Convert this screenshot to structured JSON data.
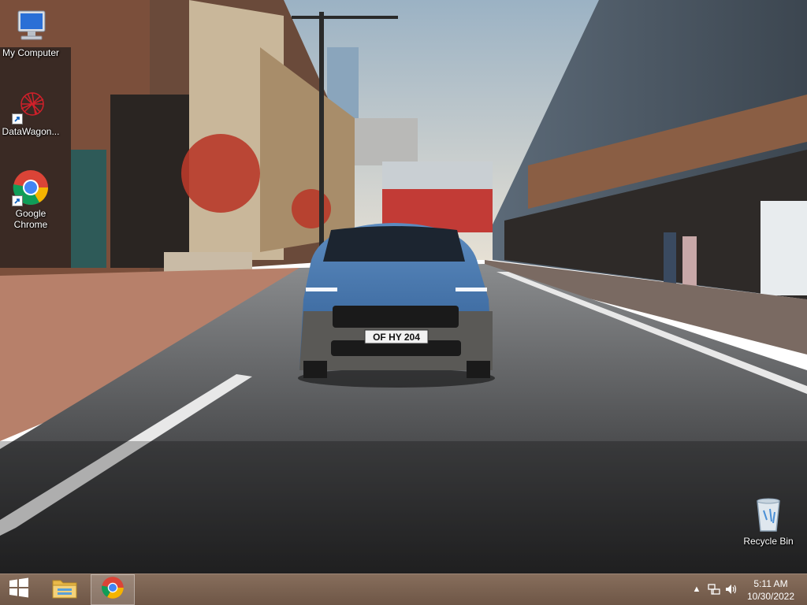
{
  "desktop": {
    "icons": [
      {
        "label": "My Computer",
        "icon": "computer-icon"
      },
      {
        "label": "DataWagon...",
        "icon": "datawagon-icon"
      },
      {
        "label": "Google Chrome",
        "icon": "chrome-icon"
      },
      {
        "label": "Recycle Bin",
        "icon": "recycle-bin-icon"
      }
    ],
    "wallpaper": {
      "description_icon": "wallpaper-image",
      "license_plate": "OF HY 204"
    }
  },
  "taskbar": {
    "start_icon": "windows-start-icon",
    "pinned": [
      {
        "icon": "file-explorer-icon",
        "active": false
      },
      {
        "icon": "chrome-icon",
        "active": true
      }
    ],
    "tray": {
      "icons": [
        "show-hidden-icons-icon",
        "network-icon",
        "volume-icon"
      ]
    },
    "clock": {
      "time": "5:11 AM",
      "date": "10/30/2022"
    }
  },
  "colors": {
    "taskbar": "#7a6251",
    "chrome_red": "#db4437",
    "chrome_yellow": "#f4b400",
    "chrome_green": "#0f9d58",
    "chrome_blue": "#4285f4"
  }
}
